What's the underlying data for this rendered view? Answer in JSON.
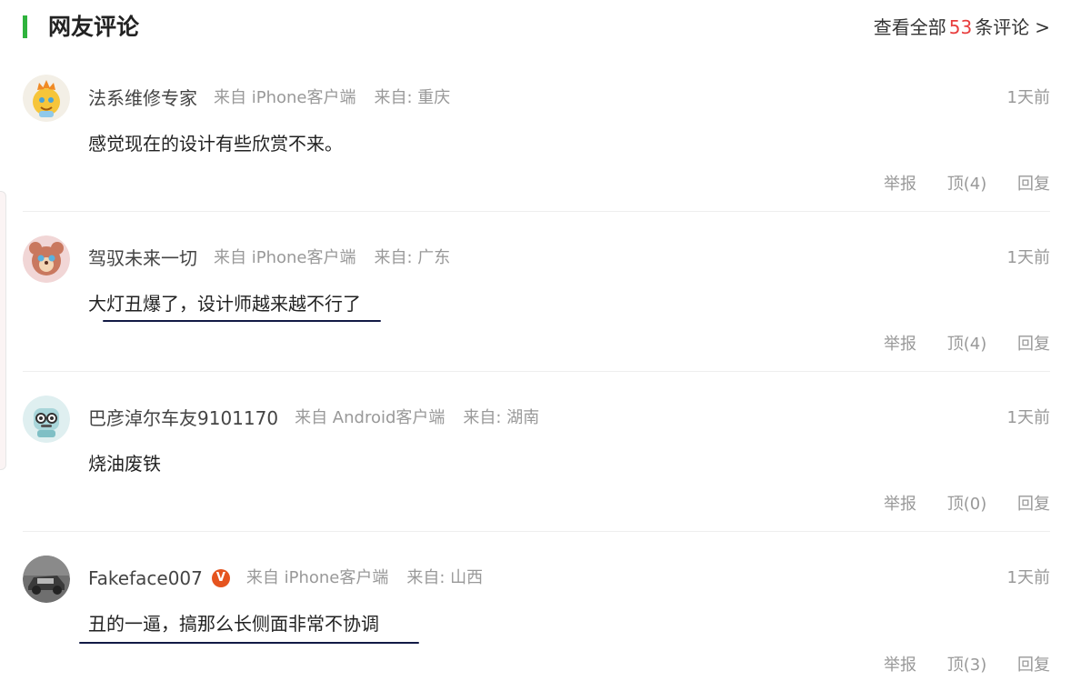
{
  "header": {
    "title": "网友评论",
    "view_all_prefix": "查看全部",
    "view_all_count": "53",
    "view_all_suffix": "条评论",
    "chevron": ">"
  },
  "colors": {
    "accent_green": "#2fb33d",
    "count_red": "#e83e3e",
    "underline_navy": "#121a45",
    "vip_orange": "#e5541f"
  },
  "comments": [
    {
      "avatar_icon": "cartoon-sun-avatar-icon",
      "username": "法系维修专家",
      "source": "来自 iPhone客户端",
      "location": "来自: 重庆",
      "time": "1天前",
      "content": "感觉现在的设计有些欣赏不来。",
      "report": "举报",
      "upvote": "顶(4)",
      "reply": "回复"
    },
    {
      "avatar_icon": "cartoon-bear-avatar-icon",
      "username": "驾驭未来一切",
      "source": "来自 iPhone客户端",
      "location": "来自: 广东",
      "time": "1天前",
      "content": "大灯丑爆了，设计师越来越不行了",
      "report": "举报",
      "upvote": "顶(4)",
      "reply": "回复"
    },
    {
      "avatar_icon": "cartoon-robot-avatar-icon",
      "username": "巴彦淖尔车友9101170",
      "source": "来自 Android客户端",
      "location": "来自: 湖南",
      "time": "1天前",
      "content": "烧油废铁",
      "report": "举报",
      "upvote": "顶(0)",
      "reply": "回复"
    },
    {
      "avatar_icon": "car-photo-avatar-icon",
      "username": "Fakeface007",
      "vip_badge": "V",
      "source": "来自 iPhone客户端",
      "location": "来自: 山西",
      "time": "1天前",
      "content": "丑的一逼，搞那么长侧面非常不协调",
      "report": "举报",
      "upvote": "顶(3)",
      "reply": "回复"
    }
  ]
}
